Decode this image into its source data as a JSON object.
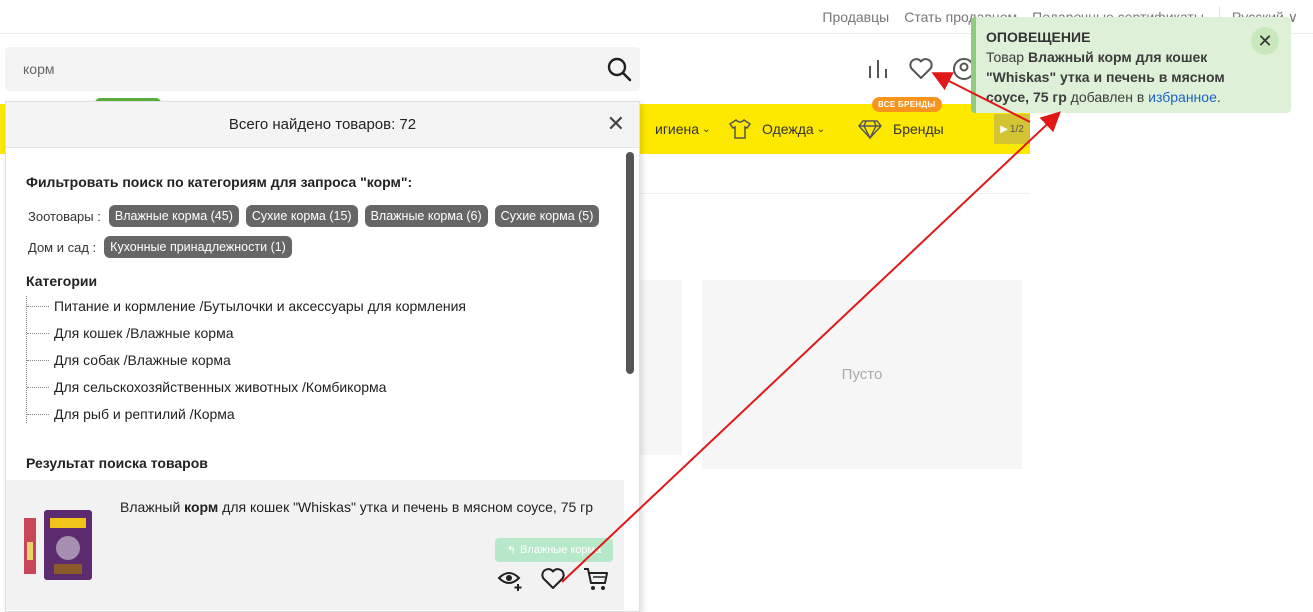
{
  "toplinks": {
    "sellers": "Продавцы",
    "become_seller": "Стать продавцом",
    "gift_cards": "Подарочные сертификаты",
    "language": "Русский ∨"
  },
  "search": {
    "value": "корм",
    "placeholder": ""
  },
  "nav": {
    "hygiene": "игиена",
    "clothes": "Одежда",
    "brands": "Бренды",
    "brands_badge": "ВСЕ БРЕНДЫ",
    "pager": "1/2"
  },
  "empty_label": "Пусто",
  "panel": {
    "total": "Всего найдено товаров: 72",
    "filter_title": "Фильтровать поиск по категориям для запроса \"корм\":",
    "groups": [
      {
        "label": "Зоотовары :",
        "chips": [
          "Влажные корма (45)",
          "Сухие корма (15)",
          "Влажные корма (6)",
          "Сухие корма (5)"
        ]
      },
      {
        "label": "Дом и сад :",
        "chips": [
          "Кухонные принадлежности (1)"
        ]
      }
    ],
    "categories_title": "Категории",
    "categories": [
      "Питание и кормление /Бутылочки и аксессуары для кормления",
      "Для кошек /Влажные корма",
      "Для собак /Влажные корма",
      "Для сельскохозяйственных животных /Комбикорма",
      "Для рыб и рептилий /Корма"
    ],
    "results_title": "Результат поиска товаров",
    "product": {
      "title_before": "Влажный ",
      "title_bold": "корм",
      "title_after": " для кошек \"Whiskas\" утка и печень в мясном соусе, 75 гр",
      "category_tag": "Влажные корма"
    }
  },
  "notification": {
    "title": "ОПОВЕЩЕНИЕ",
    "text_prefix": "Товар ",
    "product_name": "Влажный корм для кошек \"Whiskas\" утка и печень в мясном соусе, 75 гр",
    "text_middle": " добавлен в ",
    "link": "избранное",
    "text_suffix": ".",
    "close": "✕"
  },
  "colors": {
    "nav_yellow": "#fde800",
    "notify_bg": "#dff0d8",
    "annotation_arrow": "#e01818",
    "chip": "#666666"
  }
}
